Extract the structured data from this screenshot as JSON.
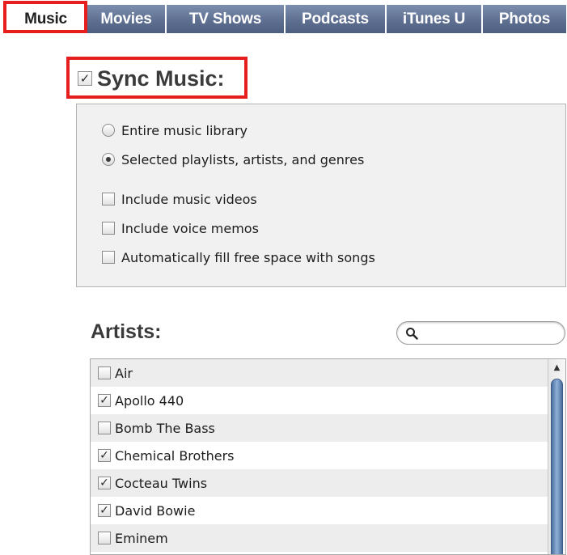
{
  "tabs": [
    {
      "label": "Music",
      "selected": true
    },
    {
      "label": "Movies",
      "selected": false
    },
    {
      "label": "TV Shows",
      "selected": false
    },
    {
      "label": "Podcasts",
      "selected": false
    },
    {
      "label": "iTunes U",
      "selected": false
    },
    {
      "label": "Photos",
      "selected": false
    }
  ],
  "sync": {
    "title": "Sync Music:",
    "checked": true
  },
  "options": {
    "radio_entire": {
      "label": "Entire music library",
      "selected": false
    },
    "radio_selected": {
      "label": "Selected playlists, artists, and genres",
      "selected": true
    },
    "include_videos": {
      "label": "Include music videos",
      "checked": false
    },
    "include_memos": {
      "label": "Include voice memos",
      "checked": false
    },
    "autofill": {
      "label": "Automatically fill free space with songs",
      "checked": false
    }
  },
  "artists": {
    "title": "Artists:",
    "search_placeholder": "",
    "items": [
      {
        "name": "Air",
        "checked": false
      },
      {
        "name": "Apollo 440",
        "checked": true
      },
      {
        "name": "Bomb The Bass",
        "checked": false
      },
      {
        "name": "Chemical Brothers",
        "checked": true
      },
      {
        "name": "Cocteau Twins",
        "checked": true
      },
      {
        "name": "David Bowie",
        "checked": true
      },
      {
        "name": "Eminem",
        "checked": false
      }
    ]
  },
  "colors": {
    "highlight_red": "#e61e1e",
    "tab_blue": "#5e6f91",
    "scroll_blue": "#6b8fbf"
  }
}
